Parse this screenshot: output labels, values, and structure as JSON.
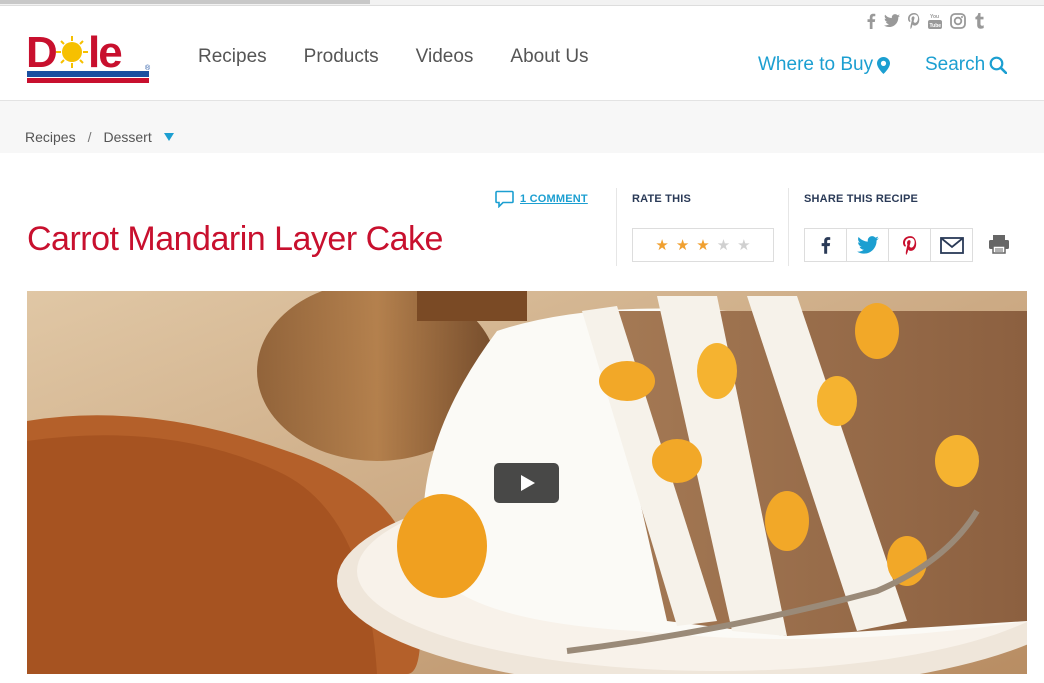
{
  "brand": {
    "logo_text": "Dole"
  },
  "nav": {
    "items": [
      "Recipes",
      "Products",
      "Videos",
      "About Us"
    ]
  },
  "social": [
    "facebook-icon",
    "twitter-icon",
    "pinterest-icon",
    "youtube-icon",
    "instagram-icon",
    "tumblr-icon"
  ],
  "utility": {
    "where_to_buy": "Where to Buy",
    "search": "Search"
  },
  "breadcrumb": {
    "items": [
      "Recipes",
      "Dessert"
    ],
    "separator": "/"
  },
  "recipe": {
    "title": "Carrot Mandarin Layer Cake",
    "comments_label": "1 COMMENT",
    "rate_label": "RATE THIS",
    "rating": 3,
    "rating_max": 5,
    "share_label": "SHARE THIS RECIPE"
  },
  "colors": {
    "accent": "#1c9fd1",
    "title": "#c8102e",
    "star_on": "#f0a030",
    "star_off": "#d0d0d0",
    "label_dark": "#2a3a57"
  }
}
